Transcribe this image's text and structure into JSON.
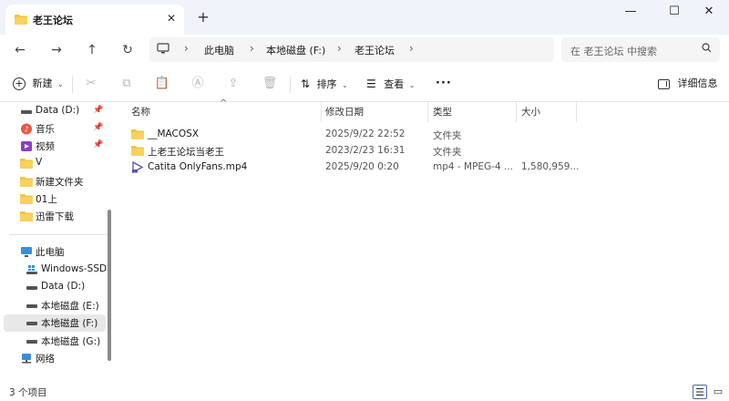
{
  "window": {
    "tab_title": "老王论坛"
  },
  "breadcrumb": {
    "items": [
      "此电脑",
      "本地磁盘 (F:)",
      "老王论坛"
    ]
  },
  "search": {
    "placeholder": "在 老王论坛 中搜索"
  },
  "toolbar": {
    "new_label": "新建",
    "sort_label": "排序",
    "view_label": "查看",
    "details_label": "详细信息"
  },
  "sidebar": {
    "items": [
      {
        "label": "Data (D:)",
        "icon": "drive-icon",
        "pinned": true
      },
      {
        "label": "音乐",
        "icon": "music-icon",
        "pinned": true
      },
      {
        "label": "视频",
        "icon": "video-icon",
        "pinned": true
      },
      {
        "label": "V",
        "icon": "folder-icon",
        "pinned": false
      },
      {
        "label": "新建文件夹",
        "icon": "folder-icon",
        "pinned": false
      },
      {
        "label": "01上",
        "icon": "folder-icon",
        "pinned": false
      },
      {
        "label": "迅雷下载",
        "icon": "folder-icon",
        "pinned": false
      }
    ],
    "this_pc": {
      "label": "此电脑",
      "drives": [
        {
          "label": "Windows-SSD",
          "icon": "windows-drive-icon"
        },
        {
          "label": "Data (D:)",
          "icon": "drive-icon"
        },
        {
          "label": "本地磁盘 (E:)",
          "icon": "drive-icon"
        },
        {
          "label": "本地磁盘 (F:)",
          "icon": "drive-icon",
          "selected": true
        },
        {
          "label": "本地磁盘 (G:)",
          "icon": "drive-icon"
        }
      ]
    },
    "network_label": "网络"
  },
  "columns": {
    "name": "名称",
    "modified": "修改日期",
    "type": "类型",
    "size": "大小"
  },
  "files": [
    {
      "name": "__MACOSX",
      "modified": "2025/9/22 22:52",
      "type": "文件夹",
      "size": "",
      "icon": "folder-icon"
    },
    {
      "name": "上老王论坛当老王",
      "modified": "2023/2/23 16:31",
      "type": "文件夹",
      "size": "",
      "icon": "folder-icon"
    },
    {
      "name": "Catita OnlyFans.mp4",
      "modified": "2025/9/20 0:20",
      "type": "mp4 - MPEG-4 ...",
      "size": "1,580,959...",
      "icon": "video-file-icon"
    }
  ],
  "status": {
    "item_count": "3 个项目"
  },
  "colors": {
    "accent": "#4a6fa5",
    "folder": "#f4c542",
    "titlebar": "#f0f3f9"
  }
}
